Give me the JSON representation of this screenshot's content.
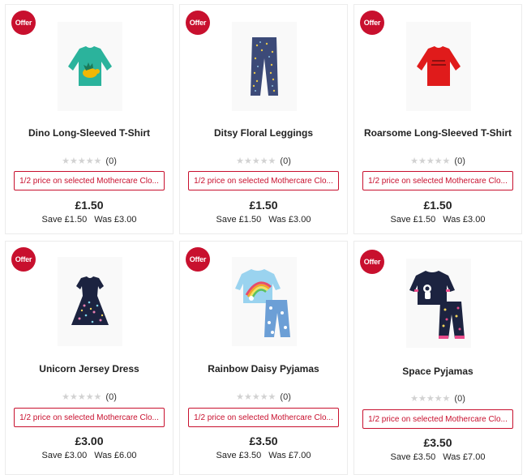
{
  "products": [
    {
      "badge": "Offer",
      "name": "Dino Long-Sleeved T-Shirt",
      "stars_glyph": "★★★★★",
      "review_count": "(0)",
      "promo": "1/2 price on selected Mothercare Clo...",
      "price": "£1.50",
      "save": "Save £1.50",
      "was": "Was £3.00",
      "image_icon": "teal-dino-tshirt-icon"
    },
    {
      "badge": "Offer",
      "name": "Ditsy Floral Leggings",
      "stars_glyph": "★★★★★",
      "review_count": "(0)",
      "promo": "1/2 price on selected Mothercare Clo...",
      "price": "£1.50",
      "save": "Save £1.50",
      "was": "Was £3.00",
      "image_icon": "floral-leggings-icon"
    },
    {
      "badge": "Offer",
      "name": "Roarsome Long-Sleeved T-Shirt",
      "stars_glyph": "★★★★★",
      "review_count": "(0)",
      "promo": "1/2 price on selected Mothercare Clo...",
      "price": "£1.50",
      "save": "Save £1.50",
      "was": "Was £3.00",
      "image_icon": "red-tshirt-icon"
    },
    {
      "badge": "Offer",
      "name": "Unicorn Jersey Dress",
      "stars_glyph": "★★★★★",
      "review_count": "(0)",
      "promo": "1/2 price on selected Mothercare Clo...",
      "price": "£3.00",
      "save": "Save £3.00",
      "was": "Was £6.00",
      "image_icon": "navy-unicorn-dress-icon"
    },
    {
      "badge": "Offer",
      "name": "Rainbow Daisy Pyjamas",
      "stars_glyph": "★★★★★",
      "review_count": "(0)",
      "promo": "1/2 price on selected Mothercare Clo...",
      "price": "£3.50",
      "save": "Save £3.50",
      "was": "Was £7.00",
      "image_icon": "rainbow-pyjamas-icon"
    },
    {
      "badge": "Offer",
      "name": "Space Pyjamas",
      "stars_glyph": "★★★★★",
      "review_count": "(0)",
      "promo": "1/2 price on selected Mothercare Clo...",
      "price": "£3.50",
      "save": "Save £3.50",
      "was": "Was £7.00",
      "image_icon": "space-pyjamas-icon"
    }
  ],
  "colors": {
    "accent": "#c8102e",
    "text": "#222222",
    "star_empty": "#d2d2d2",
    "border": "#ececec"
  }
}
